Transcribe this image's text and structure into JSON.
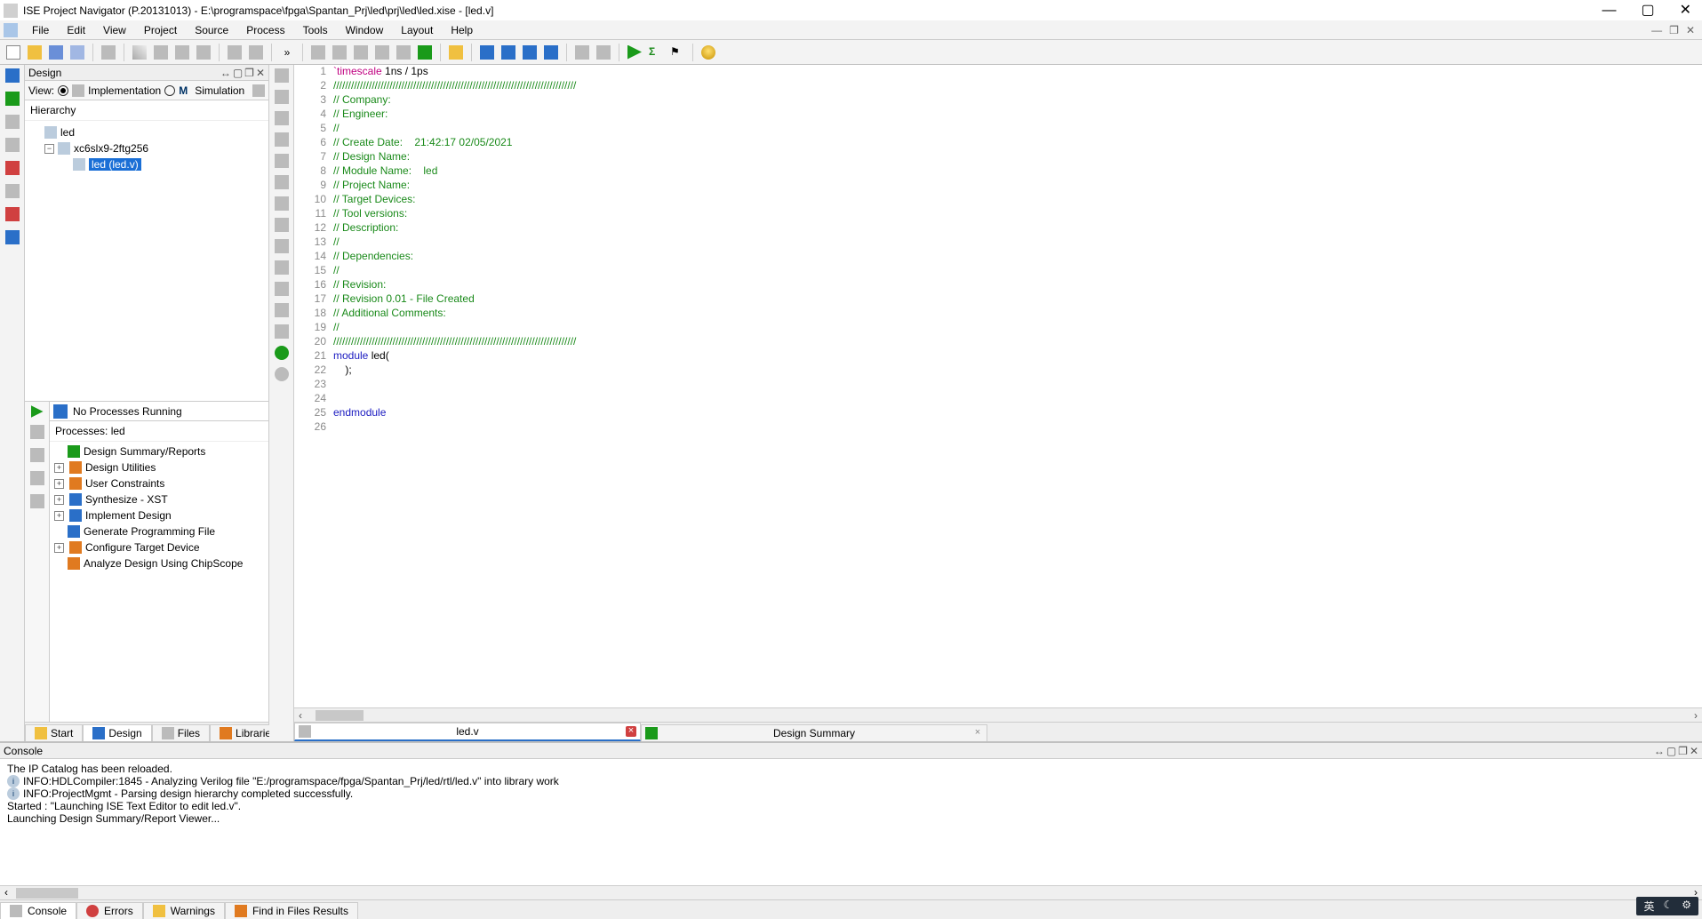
{
  "title": "ISE Project Navigator (P.20131013) - E:\\programspace\\fpga\\Spantan_Prj\\led\\prj\\led\\led.xise - [led.v]",
  "menu": {
    "items": [
      "File",
      "Edit",
      "View",
      "Project",
      "Source",
      "Process",
      "Tools",
      "Window",
      "Layout",
      "Help"
    ]
  },
  "design_panel": {
    "title": "Design",
    "view_label": "View:",
    "impl": "Implementation",
    "sim": "Simulation",
    "hierarchy_title": "Hierarchy",
    "nodes": {
      "root": "led",
      "device": "xc6slx9-2ftg256",
      "file": "led (led.v)"
    },
    "proc_status": "No Processes Running",
    "processes_title": "Processes: led",
    "processes": [
      "Design Summary/Reports",
      "Design Utilities",
      "User Constraints",
      "Synthesize - XST",
      "Implement Design",
      "Generate Programming File",
      "Configure Target Device",
      "Analyze Design Using ChipScope"
    ],
    "tabs": {
      "start": "Start",
      "design": "Design",
      "files": "Files",
      "libraries": "Libraries"
    }
  },
  "editor": {
    "lines": [
      {
        "n": 1,
        "seg": [
          [
            "red",
            "`timescale"
          ],
          [
            "",
            ""
          ],
          [
            "",
            " 1ns / 1ps"
          ]
        ]
      },
      {
        "n": 2,
        "seg": [
          [
            "green",
            "//////////////////////////////////////////////////////////////////////////////////"
          ]
        ]
      },
      {
        "n": 3,
        "seg": [
          [
            "green",
            "// Company:"
          ]
        ]
      },
      {
        "n": 4,
        "seg": [
          [
            "green",
            "// Engineer:"
          ]
        ]
      },
      {
        "n": 5,
        "seg": [
          [
            "green",
            "//"
          ]
        ]
      },
      {
        "n": 6,
        "seg": [
          [
            "green",
            "// Create Date:    21:42:17 02/05/2021"
          ]
        ]
      },
      {
        "n": 7,
        "seg": [
          [
            "green",
            "// Design Name:"
          ]
        ]
      },
      {
        "n": 8,
        "seg": [
          [
            "green",
            "// Module Name:    led"
          ]
        ]
      },
      {
        "n": 9,
        "seg": [
          [
            "green",
            "// Project Name:"
          ]
        ]
      },
      {
        "n": 10,
        "seg": [
          [
            "green",
            "// Target Devices:"
          ]
        ]
      },
      {
        "n": 11,
        "seg": [
          [
            "green",
            "// Tool versions:"
          ]
        ]
      },
      {
        "n": 12,
        "seg": [
          [
            "green",
            "// Description:"
          ]
        ]
      },
      {
        "n": 13,
        "seg": [
          [
            "green",
            "//"
          ]
        ]
      },
      {
        "n": 14,
        "seg": [
          [
            "green",
            "// Dependencies:"
          ]
        ]
      },
      {
        "n": 15,
        "seg": [
          [
            "green",
            "//"
          ]
        ]
      },
      {
        "n": 16,
        "seg": [
          [
            "green",
            "// Revision:"
          ]
        ]
      },
      {
        "n": 17,
        "seg": [
          [
            "green",
            "// Revision 0.01 - File Created"
          ]
        ]
      },
      {
        "n": 18,
        "seg": [
          [
            "green",
            "// Additional Comments:"
          ]
        ]
      },
      {
        "n": 19,
        "seg": [
          [
            "green",
            "//"
          ]
        ]
      },
      {
        "n": 20,
        "seg": [
          [
            "green",
            "//////////////////////////////////////////////////////////////////////////////////"
          ]
        ]
      },
      {
        "n": 21,
        "seg": [
          [
            "blue",
            "module"
          ],
          [
            "",
            " led("
          ]
        ]
      },
      {
        "n": 22,
        "seg": [
          [
            "",
            "    );"
          ]
        ]
      },
      {
        "n": 23,
        "seg": [
          [
            "",
            ""
          ]
        ]
      },
      {
        "n": 24,
        "seg": [
          [
            "",
            ""
          ]
        ]
      },
      {
        "n": 25,
        "seg": [
          [
            "blue",
            "endmodule"
          ]
        ]
      },
      {
        "n": 26,
        "seg": [
          [
            "",
            ""
          ]
        ]
      }
    ],
    "tabs": {
      "file": "led.v",
      "summary": "Design Summary"
    }
  },
  "console": {
    "title": "Console",
    "lines": [
      {
        "t": "  The IP Catalog has been reloaded."
      },
      {
        "i": true,
        "t": "INFO:HDLCompiler:1845 - Analyzing Verilog file \"E:/programspace/fpga/Spantan_Prj/led/rtl/led.v\" into library work"
      },
      {
        "i": true,
        "t": "INFO:ProjectMgmt - Parsing design hierarchy completed successfully."
      },
      {
        "t": ""
      },
      {
        "t": "Started : \"Launching ISE Text Editor to edit led.v\"."
      },
      {
        "t": "Launching Design Summary/Report Viewer..."
      }
    ],
    "tabs": {
      "console": "Console",
      "errors": "Errors",
      "warnings": "Warnings",
      "find": "Find in Files Results"
    }
  },
  "tray": {
    "ime": "英"
  }
}
